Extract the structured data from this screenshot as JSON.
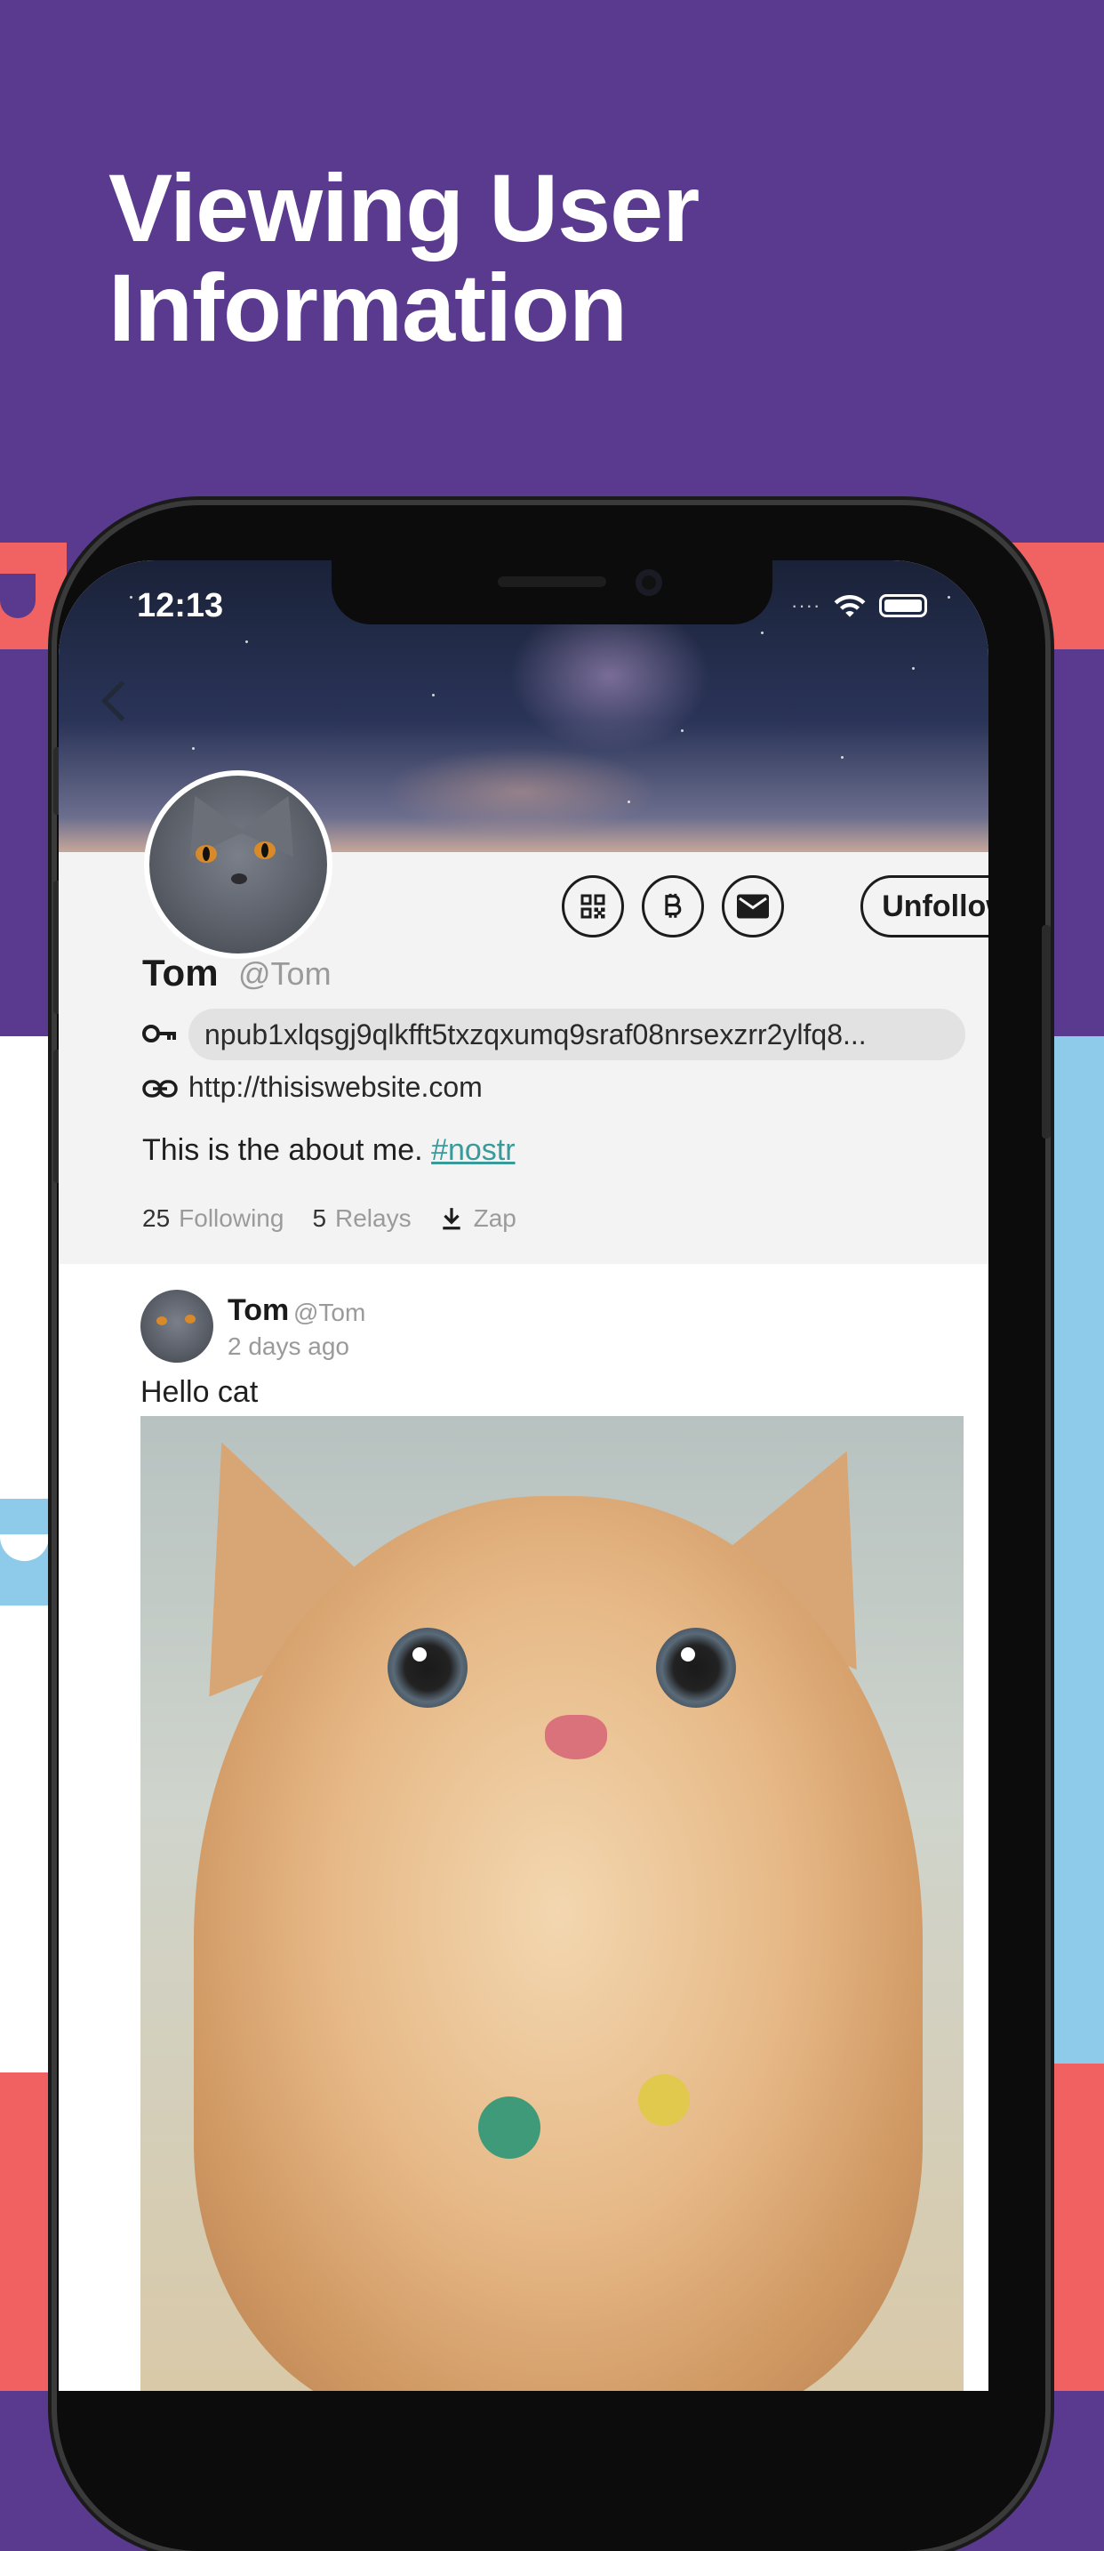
{
  "headline": "Viewing User Information",
  "status_bar": {
    "time": "12:13",
    "icons": [
      "signal-icon",
      "wifi-icon",
      "battery-icon"
    ]
  },
  "profile": {
    "display_name": "Tom",
    "handle": "@Tom",
    "npub": "npub1xlqsgj9qlkfft5txzqxumq9sraf08nrsexzrr2ylfq8...",
    "website": "http://thisiswebsite.com",
    "about": "This is the about me.",
    "about_tag": "#nostr",
    "following_count": "25",
    "following_label": "Following",
    "relays_count": "5",
    "relays_label": "Relays",
    "zap_label": "Zap",
    "unfollow_label": "Unfollow",
    "action_icons": [
      "qr-code-icon",
      "bitcoin-icon",
      "message-icon"
    ]
  },
  "post": {
    "author": "Tom",
    "handle": "@Tom",
    "time": "2 days ago",
    "text": "Hello cat"
  },
  "colors": {
    "purple_bg": "#5a3a8e",
    "red_accent": "#f26162",
    "blue_accent": "#8ecbea",
    "tag_color": "#3a9a9a"
  }
}
